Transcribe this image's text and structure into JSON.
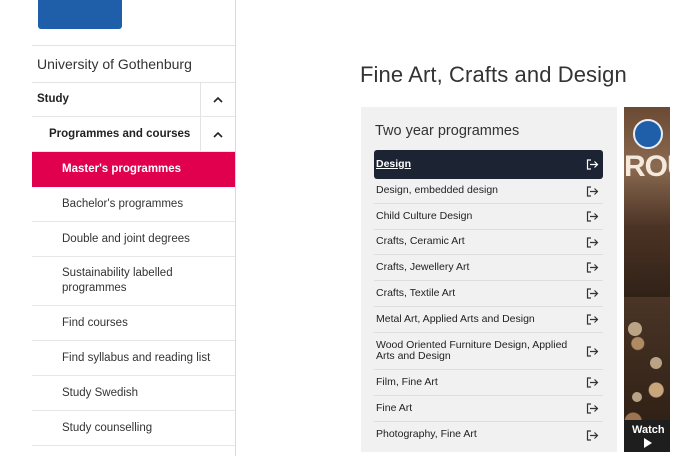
{
  "sidebar": {
    "university": "University of Gothenburg",
    "study_label": "Study",
    "programmes_label": "Programmes and courses",
    "items": [
      {
        "label": "Master's programmes",
        "active": true
      },
      {
        "label": "Bachelor's programmes"
      },
      {
        "label": "Double and joint degrees"
      },
      {
        "label": "Sustainability labelled programmes"
      },
      {
        "label": "Find courses"
      },
      {
        "label": "Find syllabus and reading list"
      },
      {
        "label": "Study Swedish"
      },
      {
        "label": "Study counselling"
      }
    ]
  },
  "main": {
    "title": "Fine Art, Crafts and Design",
    "card_title": "Two year programmes",
    "programmes": [
      "Design",
      "Design, embedded design",
      "Child Culture Design",
      "Crafts, Ceramic Art",
      "Crafts, Jewellery Art",
      "Crafts, Textile Art",
      "Metal Art, Applied Arts and Design",
      "Wood Oriented Furniture Design, Applied Arts and Design",
      "Film, Fine Art",
      "Fine Art",
      "Photography, Fine Art"
    ]
  },
  "video": {
    "overlay_text": "ROU",
    "watch_label": "Watch"
  },
  "colors": {
    "active_nav": "#e0004d",
    "selected_programme": "#1c2333",
    "brand_blue": "#1f5faa"
  }
}
